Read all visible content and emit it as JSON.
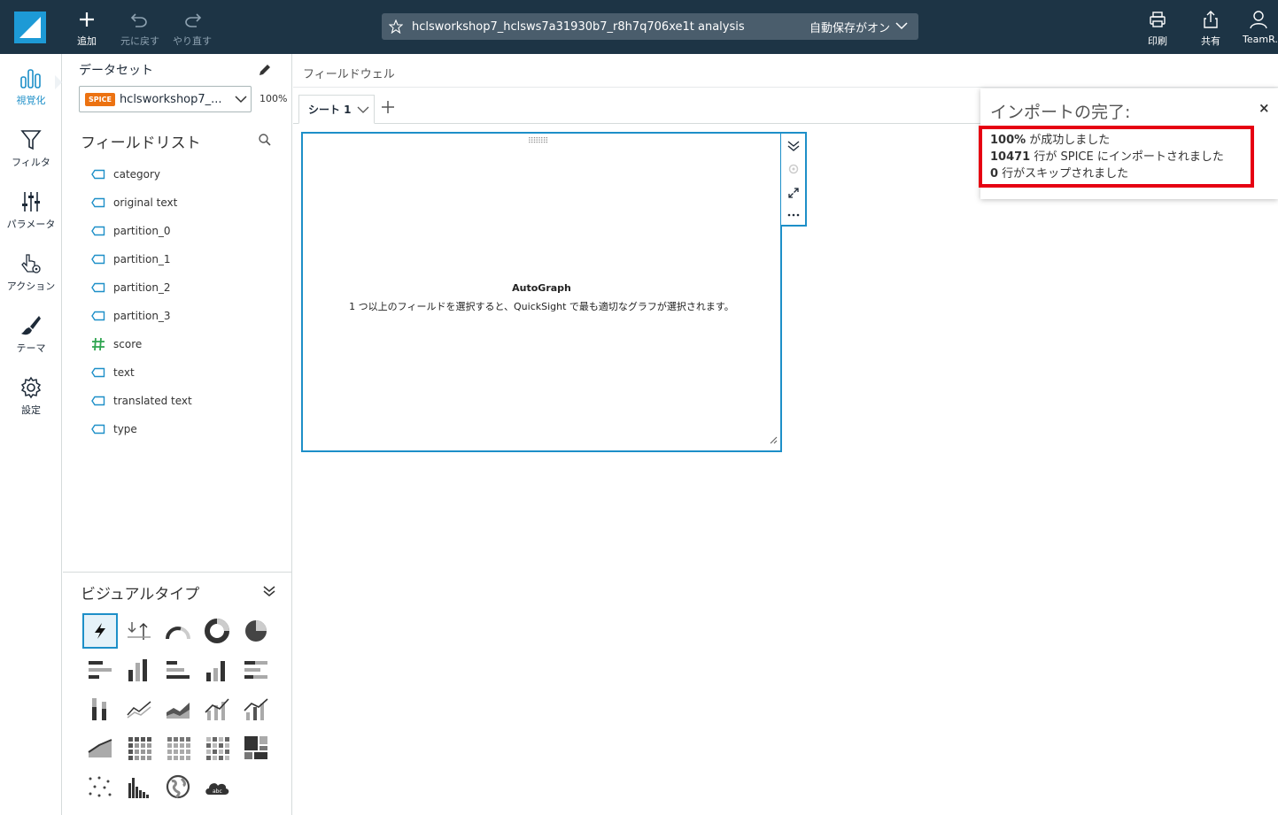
{
  "topbar": {
    "add_label": "追加",
    "undo_label": "元に戻す",
    "redo_label": "やり直す",
    "title": "hclsworkshop7_hclsws7a31930b7_r8h7q706xe1t analysis",
    "autosave": "自動保存がオン",
    "print_label": "印刷",
    "share_label": "共有",
    "user_label": "TeamR..."
  },
  "nav": {
    "items": [
      {
        "label": "視覚化",
        "icon": "bar-chart-icon"
      },
      {
        "label": "フィルタ",
        "icon": "funnel-icon"
      },
      {
        "label": "パラメータ",
        "icon": "sliders-icon"
      },
      {
        "label": "アクション",
        "icon": "hand-pointer-icon"
      },
      {
        "label": "テーマ",
        "icon": "brush-icon"
      },
      {
        "label": "設定",
        "icon": "gear-icon"
      }
    ]
  },
  "dataset": {
    "title": "データセット",
    "badge": "SPICE",
    "name": "hclsworkshop7_...",
    "percent": "100%"
  },
  "fieldlist": {
    "title": "フィールドリスト",
    "fields": [
      {
        "name": "category",
        "type": "dimension"
      },
      {
        "name": "original text",
        "type": "dimension"
      },
      {
        "name": "partition_0",
        "type": "dimension"
      },
      {
        "name": "partition_1",
        "type": "dimension"
      },
      {
        "name": "partition_2",
        "type": "dimension"
      },
      {
        "name": "partition_3",
        "type": "dimension"
      },
      {
        "name": "score",
        "type": "measure"
      },
      {
        "name": "text",
        "type": "dimension"
      },
      {
        "name": "translated text",
        "type": "dimension"
      },
      {
        "name": "type",
        "type": "dimension"
      }
    ]
  },
  "visualtypes": {
    "title": "ビジュアルタイプ"
  },
  "main": {
    "fieldwell_label": "フィールドウェル",
    "sheet_tab": "シート 1",
    "autograph_title": "AutoGraph",
    "autograph_desc": "1 つ以上のフィールドを選択すると、QuickSight で最も適切なグラフが選択されます。"
  },
  "notification": {
    "title": "インポートの完了:",
    "close": "×",
    "line1_bold": "100%",
    "line1_rest": " が成功しました",
    "line2_bold": "10471",
    "line2_rest": " 行が SPICE にインポートされました",
    "line3_bold": "0",
    "line3_rest": " 行がスキップされました"
  },
  "colors": {
    "topbar": "#1d3445",
    "accent": "#1d8fc8",
    "spice": "#ec7211",
    "highlight_box": "#e60012",
    "measure": "#2ea44f"
  }
}
